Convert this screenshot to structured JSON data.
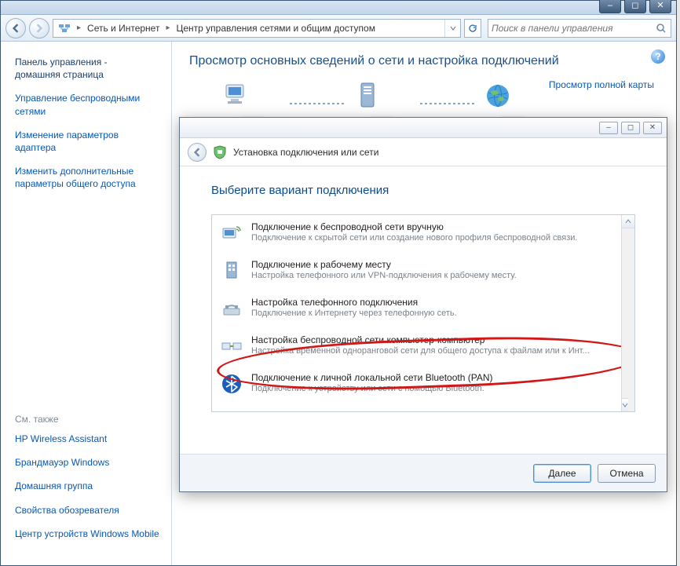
{
  "titlebar": {
    "minimize": "–",
    "maximize": "◻",
    "close": "✕"
  },
  "nav": {
    "path1": "Сеть и Интернет",
    "path2": "Центр управления сетями и общим доступом",
    "search_placeholder": "Поиск в панели управления"
  },
  "sidebar": {
    "home_line1": "Панель управления -",
    "home_line2": "домашняя страница",
    "links": [
      "Управление беспроводными сетями",
      "Изменение параметров адаптера",
      "Изменить дополнительные параметры общего доступа"
    ],
    "see_also_hdr": "См. также",
    "see_also": [
      "HP Wireless Assistant",
      "Брандмауэр Windows",
      "Домашняя группа",
      "Свойства обозревателя",
      "Центр устройств Windows Mobile"
    ]
  },
  "content": {
    "heading": "Просмотр основных сведений о сети и настройка подключений",
    "full_map": "Просмотр полной карты"
  },
  "wizard": {
    "titlebar": {
      "minimize": "–",
      "maximize": "◻",
      "close": "✕"
    },
    "header": "Установка подключения или сети",
    "heading": "Выберите вариант подключения",
    "options": [
      {
        "title": "Подключение к беспроводной сети вручную",
        "desc": "Подключение к скрытой сети или создание нового профиля беспроводной связи."
      },
      {
        "title": "Подключение к рабочему месту",
        "desc": "Настройка телефонного или VPN-подключения к рабочему месту."
      },
      {
        "title": "Настройка телефонного подключения",
        "desc": "Подключение к Интернету через телефонную сеть."
      },
      {
        "title": "Настройка беспроводной сети компьютер-компьютер",
        "desc": "Настройка временной одноранговой сети для общего доступа к файлам или к Инт..."
      },
      {
        "title": "Подключение к личной локальной сети Bluetooth (PAN)",
        "desc": "Подключение к устройству или сети с помощью Bluetooth."
      }
    ],
    "next": "Далее",
    "cancel": "Отмена"
  }
}
